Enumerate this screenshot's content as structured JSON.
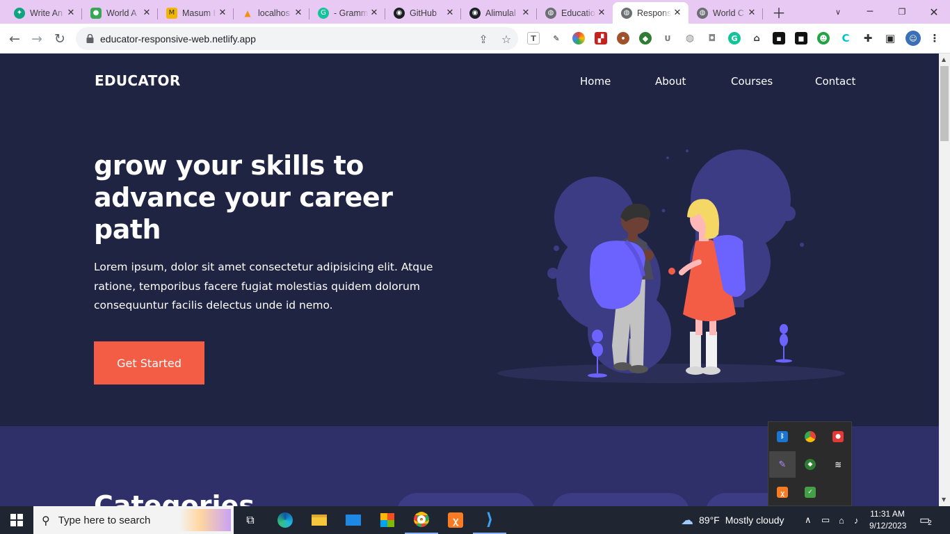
{
  "browser": {
    "tabs": [
      {
        "label": "Write An",
        "icon": "chatgpt-icon",
        "color": "#10a37f"
      },
      {
        "label": "World A",
        "icon": "map-pin-icon",
        "color": "#34a853"
      },
      {
        "label": "Masum I",
        "icon": "masum-logo-icon",
        "color": "#f1b600"
      },
      {
        "label": "localhos",
        "icon": "phpmyadmin-icon",
        "color": "#f29111"
      },
      {
        "label": "- Gramm",
        "icon": "grammarly-icon",
        "color": "#15c39a"
      },
      {
        "label": "GitHub",
        "icon": "github-icon",
        "color": "#1b1f23"
      },
      {
        "label": "Alimulal",
        "icon": "github-icon",
        "color": "#1b1f23"
      },
      {
        "label": "Educatio",
        "icon": "globe-icon",
        "color": "#5f6368"
      },
      {
        "label": "Respons",
        "icon": "globe-icon",
        "color": "#5f6368",
        "active": true
      },
      {
        "label": "World C",
        "icon": "globe-icon",
        "color": "#5f6368"
      }
    ],
    "url": "educator-responsive-web.netlify.app"
  },
  "site": {
    "brand": "EDUCATOR",
    "nav": [
      "Home",
      "About",
      "Courses",
      "Contact"
    ],
    "hero_title": "grow your skills to advance your career path",
    "hero_text": "Lorem ipsum, dolor sit amet consectetur adipisicing elit. Atque ratione, temporibus facere fugiat molestias quidem dolorum consequuntur facilis delectus unde id nemo.",
    "cta": "Get Started",
    "categories_title": "Categories",
    "colors": {
      "bg": "#1f2443",
      "accent": "#f35d46",
      "section2": "#2f2f6a",
      "illustration": "#3b3c84"
    }
  },
  "taskbar": {
    "search_placeholder": "Type here to search",
    "weather_temp": "89°F",
    "weather_text": "Mostly cloudy",
    "time": "11:31 AM",
    "date": "9/12/2023",
    "notifications": "2"
  }
}
